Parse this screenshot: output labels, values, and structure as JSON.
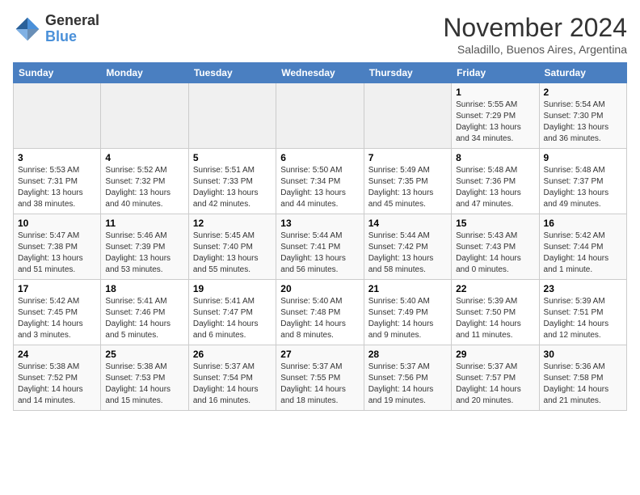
{
  "logo": {
    "text_general": "General",
    "text_blue": "Blue"
  },
  "title": "November 2024",
  "subtitle": "Saladillo, Buenos Aires, Argentina",
  "days_of_week": [
    "Sunday",
    "Monday",
    "Tuesday",
    "Wednesday",
    "Thursday",
    "Friday",
    "Saturday"
  ],
  "weeks": [
    [
      {
        "day": "",
        "sunrise": "",
        "sunset": "",
        "daylight": ""
      },
      {
        "day": "",
        "sunrise": "",
        "sunset": "",
        "daylight": ""
      },
      {
        "day": "",
        "sunrise": "",
        "sunset": "",
        "daylight": ""
      },
      {
        "day": "",
        "sunrise": "",
        "sunset": "",
        "daylight": ""
      },
      {
        "day": "",
        "sunrise": "",
        "sunset": "",
        "daylight": ""
      },
      {
        "day": "1",
        "sunrise": "Sunrise: 5:55 AM",
        "sunset": "Sunset: 7:29 PM",
        "daylight": "Daylight: 13 hours and 34 minutes."
      },
      {
        "day": "2",
        "sunrise": "Sunrise: 5:54 AM",
        "sunset": "Sunset: 7:30 PM",
        "daylight": "Daylight: 13 hours and 36 minutes."
      }
    ],
    [
      {
        "day": "3",
        "sunrise": "Sunrise: 5:53 AM",
        "sunset": "Sunset: 7:31 PM",
        "daylight": "Daylight: 13 hours and 38 minutes."
      },
      {
        "day": "4",
        "sunrise": "Sunrise: 5:52 AM",
        "sunset": "Sunset: 7:32 PM",
        "daylight": "Daylight: 13 hours and 40 minutes."
      },
      {
        "day": "5",
        "sunrise": "Sunrise: 5:51 AM",
        "sunset": "Sunset: 7:33 PM",
        "daylight": "Daylight: 13 hours and 42 minutes."
      },
      {
        "day": "6",
        "sunrise": "Sunrise: 5:50 AM",
        "sunset": "Sunset: 7:34 PM",
        "daylight": "Daylight: 13 hours and 44 minutes."
      },
      {
        "day": "7",
        "sunrise": "Sunrise: 5:49 AM",
        "sunset": "Sunset: 7:35 PM",
        "daylight": "Daylight: 13 hours and 45 minutes."
      },
      {
        "day": "8",
        "sunrise": "Sunrise: 5:48 AM",
        "sunset": "Sunset: 7:36 PM",
        "daylight": "Daylight: 13 hours and 47 minutes."
      },
      {
        "day": "9",
        "sunrise": "Sunrise: 5:48 AM",
        "sunset": "Sunset: 7:37 PM",
        "daylight": "Daylight: 13 hours and 49 minutes."
      }
    ],
    [
      {
        "day": "10",
        "sunrise": "Sunrise: 5:47 AM",
        "sunset": "Sunset: 7:38 PM",
        "daylight": "Daylight: 13 hours and 51 minutes."
      },
      {
        "day": "11",
        "sunrise": "Sunrise: 5:46 AM",
        "sunset": "Sunset: 7:39 PM",
        "daylight": "Daylight: 13 hours and 53 minutes."
      },
      {
        "day": "12",
        "sunrise": "Sunrise: 5:45 AM",
        "sunset": "Sunset: 7:40 PM",
        "daylight": "Daylight: 13 hours and 55 minutes."
      },
      {
        "day": "13",
        "sunrise": "Sunrise: 5:44 AM",
        "sunset": "Sunset: 7:41 PM",
        "daylight": "Daylight: 13 hours and 56 minutes."
      },
      {
        "day": "14",
        "sunrise": "Sunrise: 5:44 AM",
        "sunset": "Sunset: 7:42 PM",
        "daylight": "Daylight: 13 hours and 58 minutes."
      },
      {
        "day": "15",
        "sunrise": "Sunrise: 5:43 AM",
        "sunset": "Sunset: 7:43 PM",
        "daylight": "Daylight: 14 hours and 0 minutes."
      },
      {
        "day": "16",
        "sunrise": "Sunrise: 5:42 AM",
        "sunset": "Sunset: 7:44 PM",
        "daylight": "Daylight: 14 hours and 1 minute."
      }
    ],
    [
      {
        "day": "17",
        "sunrise": "Sunrise: 5:42 AM",
        "sunset": "Sunset: 7:45 PM",
        "daylight": "Daylight: 14 hours and 3 minutes."
      },
      {
        "day": "18",
        "sunrise": "Sunrise: 5:41 AM",
        "sunset": "Sunset: 7:46 PM",
        "daylight": "Daylight: 14 hours and 5 minutes."
      },
      {
        "day": "19",
        "sunrise": "Sunrise: 5:41 AM",
        "sunset": "Sunset: 7:47 PM",
        "daylight": "Daylight: 14 hours and 6 minutes."
      },
      {
        "day": "20",
        "sunrise": "Sunrise: 5:40 AM",
        "sunset": "Sunset: 7:48 PM",
        "daylight": "Daylight: 14 hours and 8 minutes."
      },
      {
        "day": "21",
        "sunrise": "Sunrise: 5:40 AM",
        "sunset": "Sunset: 7:49 PM",
        "daylight": "Daylight: 14 hours and 9 minutes."
      },
      {
        "day": "22",
        "sunrise": "Sunrise: 5:39 AM",
        "sunset": "Sunset: 7:50 PM",
        "daylight": "Daylight: 14 hours and 11 minutes."
      },
      {
        "day": "23",
        "sunrise": "Sunrise: 5:39 AM",
        "sunset": "Sunset: 7:51 PM",
        "daylight": "Daylight: 14 hours and 12 minutes."
      }
    ],
    [
      {
        "day": "24",
        "sunrise": "Sunrise: 5:38 AM",
        "sunset": "Sunset: 7:52 PM",
        "daylight": "Daylight: 14 hours and 14 minutes."
      },
      {
        "day": "25",
        "sunrise": "Sunrise: 5:38 AM",
        "sunset": "Sunset: 7:53 PM",
        "daylight": "Daylight: 14 hours and 15 minutes."
      },
      {
        "day": "26",
        "sunrise": "Sunrise: 5:37 AM",
        "sunset": "Sunset: 7:54 PM",
        "daylight": "Daylight: 14 hours and 16 minutes."
      },
      {
        "day": "27",
        "sunrise": "Sunrise: 5:37 AM",
        "sunset": "Sunset: 7:55 PM",
        "daylight": "Daylight: 14 hours and 18 minutes."
      },
      {
        "day": "28",
        "sunrise": "Sunrise: 5:37 AM",
        "sunset": "Sunset: 7:56 PM",
        "daylight": "Daylight: 14 hours and 19 minutes."
      },
      {
        "day": "29",
        "sunrise": "Sunrise: 5:37 AM",
        "sunset": "Sunset: 7:57 PM",
        "daylight": "Daylight: 14 hours and 20 minutes."
      },
      {
        "day": "30",
        "sunrise": "Sunrise: 5:36 AM",
        "sunset": "Sunset: 7:58 PM",
        "daylight": "Daylight: 14 hours and 21 minutes."
      }
    ]
  ]
}
